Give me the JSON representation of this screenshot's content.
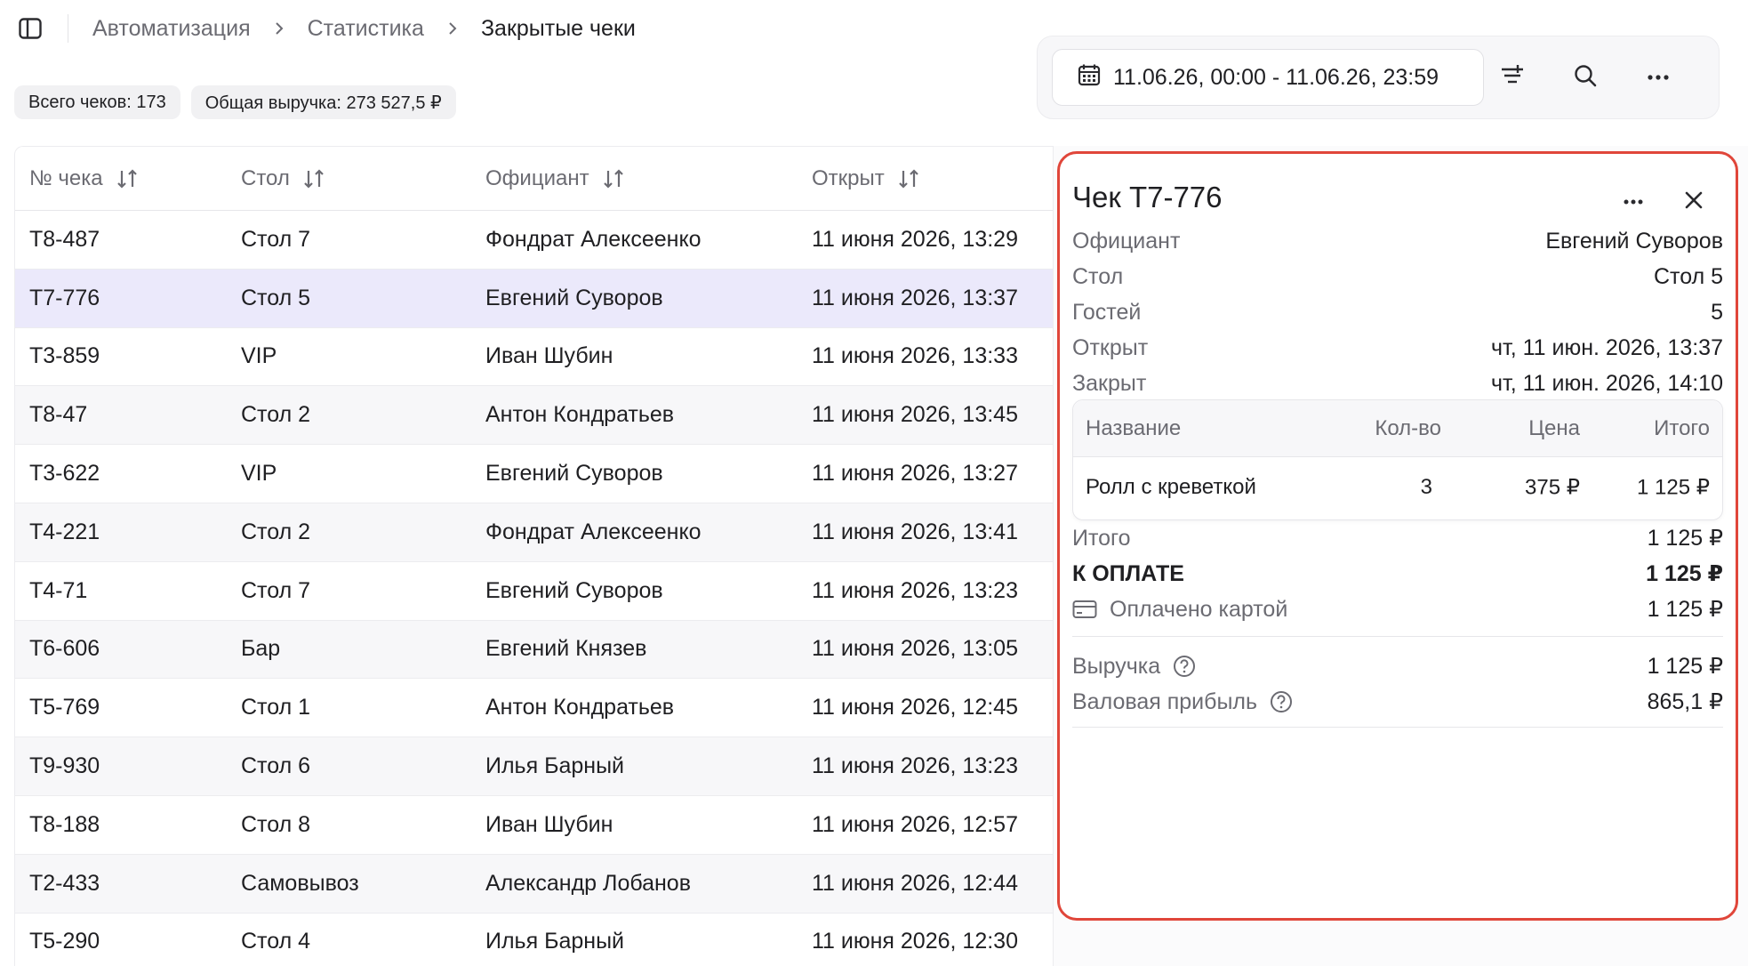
{
  "breadcrumb": {
    "items": [
      "Автоматизация",
      "Статистика",
      "Закрытые чеки"
    ]
  },
  "stats": {
    "total_checks": "Всего чеков: 173",
    "total_revenue": "Общая выручка: 273 527,5 ₽"
  },
  "toolbar": {
    "date_range": "11.06.26, 00:00 - 11.06.26, 23:59"
  },
  "table": {
    "columns": [
      "№ чека",
      "Стол",
      "Официант",
      "Открыт"
    ],
    "rows": [
      {
        "num": "T8-487",
        "table": "Стол 7",
        "waiter": "Фондрат Алексеенко",
        "opened": "11 июня 2026, 13:29"
      },
      {
        "num": "T7-776",
        "table": "Стол 5",
        "waiter": "Евгений Суворов",
        "opened": "11 июня 2026, 13:37"
      },
      {
        "num": "T3-859",
        "table": "VIP",
        "waiter": "Иван Шубин",
        "opened": "11 июня 2026, 13:33"
      },
      {
        "num": "T8-47",
        "table": "Стол 2",
        "waiter": "Антон Кондратьев",
        "opened": "11 июня 2026, 13:45"
      },
      {
        "num": "T3-622",
        "table": "VIP",
        "waiter": "Евгений Суворов",
        "opened": "11 июня 2026, 13:27"
      },
      {
        "num": "T4-221",
        "table": "Стол 2",
        "waiter": "Фондрат Алексеенко",
        "opened": "11 июня 2026, 13:41"
      },
      {
        "num": "T4-71",
        "table": "Стол 7",
        "waiter": "Евгений Суворов",
        "opened": "11 июня 2026, 13:23"
      },
      {
        "num": "T6-606",
        "table": "Бар",
        "waiter": "Евгений Князев",
        "opened": "11 июня 2026, 13:05"
      },
      {
        "num": "T5-769",
        "table": "Стол 1",
        "waiter": "Антон Кондратьев",
        "opened": "11 июня 2026, 12:45"
      },
      {
        "num": "T9-930",
        "table": "Стол 6",
        "waiter": "Илья Барный",
        "opened": "11 июня 2026, 13:23"
      },
      {
        "num": "T8-188",
        "table": "Стол 8",
        "waiter": "Иван Шубин",
        "opened": "11 июня 2026, 12:57"
      },
      {
        "num": "T2-433",
        "table": "Самовывоз",
        "waiter": "Александр Лобанов",
        "opened": "11 июня 2026, 12:44"
      },
      {
        "num": "T5-290",
        "table": "Стол 4",
        "waiter": "Илья Барный",
        "opened": "11 июня 2026, 12:30"
      }
    ]
  },
  "panel": {
    "title": "Чек T7-776",
    "info": [
      {
        "label": "Официант",
        "value": "Евгений Суворов"
      },
      {
        "label": "Стол",
        "value": "Стол 5"
      },
      {
        "label": "Гостей",
        "value": "5"
      },
      {
        "label": "Открыт",
        "value": "чт, 11 июн. 2026, 13:37"
      },
      {
        "label": "Закрыт",
        "value": "чт, 11 июн. 2026, 14:10"
      }
    ],
    "items_columns": {
      "name": "Название",
      "qty": "Кол-во",
      "price": "Цена",
      "total": "Итого"
    },
    "items": [
      {
        "name": "Ролл с креветкой",
        "qty": "3",
        "price": "375 ₽",
        "total": "1 125 ₽"
      }
    ],
    "summary": {
      "subtotal_label": "Итого",
      "subtotal": "1 125 ₽",
      "to_pay_label": "К ОПЛАТЕ",
      "to_pay": "1 125 ₽",
      "paid_card_label": "Оплачено картой",
      "paid_card": "1 125 ₽",
      "revenue_label": "Выручка",
      "revenue": "1 125 ₽",
      "gross_profit_label": "Валовая прибыль",
      "gross_profit": "865,1 ₽"
    }
  },
  "colors": {
    "selected_row": "#ebe9fb",
    "highlight_border": "#e0463a",
    "muted_text": "#6b6b72"
  }
}
